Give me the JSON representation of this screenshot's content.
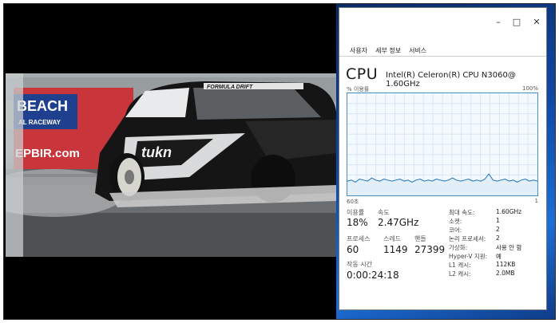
{
  "video": {
    "banner_top": "BEACH",
    "banner_mid": "AL RACEWAY",
    "banner_url": "EPBIR.com",
    "car_windshield": "FORMULA DRIFT",
    "car_door": "tukn"
  },
  "taskmgr": {
    "tabs": [
      "사용자",
      "세부 정보",
      "서비스"
    ],
    "cpu_title": "CPU",
    "cpu_name": "Intel(R) Celeron(R) CPU N3060@ 1.60GHz",
    "util_label": "% 이용률",
    "util_max": "100%",
    "graph_time": "60초",
    "graph_min": "1",
    "stats": {
      "utilization_label": "이용률",
      "utilization": "18%",
      "speed_label": "속도",
      "speed": "2.47GHz",
      "processes_label": "프로세스",
      "processes": "60",
      "threads_label": "스레드",
      "threads": "1149",
      "handles_label": "핸들",
      "handles": "27399",
      "uptime_label": "작동 시간",
      "uptime": "0:00:24:18"
    },
    "specs": [
      {
        "label": "최대 속도:",
        "value": "1.60GHz"
      },
      {
        "label": "소켓:",
        "value": "1"
      },
      {
        "label": "코어:",
        "value": "2"
      },
      {
        "label": "논리 프로세서:",
        "value": "2"
      },
      {
        "label": "가상화:",
        "value": "사용 안 함"
      },
      {
        "label": "Hyper-V 지원:",
        "value": "예"
      },
      {
        "label": "L1 캐시:",
        "value": "112KB"
      },
      {
        "label": "L2 캐시:",
        "value": "2.0MB"
      }
    ],
    "graph_utilization_series": [
      14,
      15,
      13,
      16,
      15,
      14,
      17,
      15,
      14,
      16,
      15,
      14,
      15,
      16,
      14,
      15,
      13,
      15,
      16,
      14,
      15,
      14,
      16,
      15,
      14,
      15,
      17,
      15,
      14,
      15,
      16,
      14,
      15,
      14,
      16,
      21,
      15,
      14,
      15,
      16,
      14,
      15,
      13,
      15,
      16,
      14,
      15,
      14
    ]
  }
}
